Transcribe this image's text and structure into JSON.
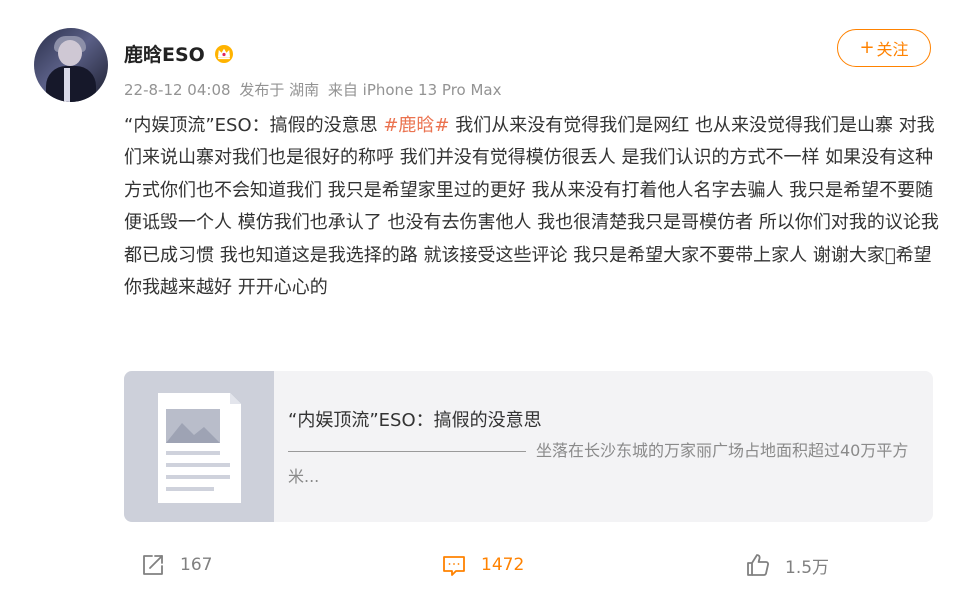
{
  "user": {
    "name": "鹿晗ESO",
    "avatar": "avatar",
    "badge_icon": "crown-icon"
  },
  "meta": {
    "time": "22-8-12 04:08",
    "published_at": "发布于 湖南",
    "source": "来自 iPhone 13 Pro Max"
  },
  "follow_button": {
    "icon": "plus-icon",
    "label": "关注"
  },
  "post": {
    "text_before": "“内娱顶流”ESO：搞假的没意思 ",
    "hashtag": "#鹿晗#",
    "text_after": " 我们从来没有觉得我们是网红 也从来没觉得我们是山寨 对我们来说山寨对我们也是很好的称呼 我们并没有觉得模仿很丢人 是我们认识的方式不一样 如果没有这种方式你们也不会知道我们 我只是希望家里过的更好 我从来没有打着他人名字去骗人 我只是希望不要随便诋毁一个人 模仿我们也承认了 也没有去伤害他人 我也很清楚我只是哥模仿者 所以你们对我的议论我都已成习惯 我也知道这是我选择的路 就该接受这些评论 我只是希望大家不要带上家人 谢谢大家􏿽希望你我越来越好 开开心心的"
  },
  "card": {
    "thumbnail_icon": "document-image-icon",
    "title": "“内娱顶流”ESO：搞假的没意思",
    "description": "坐落在长沙东城的万家丽广场占地面积超过40万平方米..."
  },
  "actions": {
    "share": {
      "icon": "share-icon",
      "count": "167"
    },
    "comment": {
      "icon": "comment-icon",
      "count": "1472",
      "color": "#ff8200"
    },
    "like": {
      "icon": "thumbs-up-icon",
      "count": "1.5万"
    }
  },
  "colors": {
    "accent": "#ff8200",
    "hashtag": "#eb7350",
    "meta_text": "#939393"
  }
}
